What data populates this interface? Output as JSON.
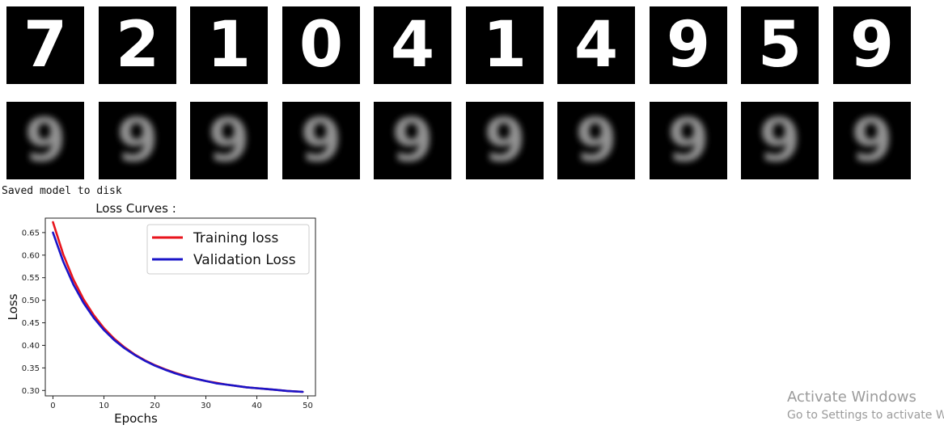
{
  "originals": [
    "7",
    "2",
    "1",
    "0",
    "4",
    "1",
    "4",
    "9",
    "5",
    "9"
  ],
  "reconstructions": [
    "9",
    "9",
    "9",
    "9",
    "9",
    "9",
    "9",
    "9",
    "9",
    "9"
  ],
  "status_text": "Saved model to disk",
  "chart_data": {
    "type": "line",
    "title": "Loss Curves :",
    "xlabel": "Epochs",
    "ylabel": "Loss",
    "xlim": [
      -1.5,
      51.5
    ],
    "ylim": [
      0.288,
      0.682
    ],
    "xticks": [
      0,
      10,
      20,
      30,
      40,
      50
    ],
    "yticks": [
      0.3,
      0.35,
      0.4,
      0.45,
      0.5,
      0.55,
      0.6,
      0.65
    ],
    "legend_position": "top-right",
    "series": [
      {
        "name": "Training loss",
        "color": "#e8141c",
        "x": [
          0,
          2,
          4,
          6,
          8,
          10,
          12,
          14,
          16,
          18,
          20,
          22,
          24,
          26,
          28,
          30,
          32,
          34,
          36,
          38,
          40,
          42,
          44,
          46,
          49
        ],
        "y": [
          0.673,
          0.602,
          0.546,
          0.502,
          0.467,
          0.438,
          0.415,
          0.396,
          0.38,
          0.367,
          0.356,
          0.347,
          0.339,
          0.332,
          0.326,
          0.321,
          0.317,
          0.313,
          0.31,
          0.307,
          0.305,
          0.303,
          0.301,
          0.299,
          0.297
        ]
      },
      {
        "name": "Validation Loss",
        "color": "#1a14c8",
        "x": [
          0,
          2,
          4,
          6,
          8,
          10,
          12,
          14,
          16,
          18,
          20,
          22,
          24,
          26,
          28,
          30,
          32,
          34,
          36,
          38,
          40,
          42,
          44,
          46,
          49
        ],
        "y": [
          0.65,
          0.586,
          0.535,
          0.494,
          0.461,
          0.434,
          0.412,
          0.394,
          0.379,
          0.366,
          0.355,
          0.346,
          0.338,
          0.331,
          0.326,
          0.321,
          0.316,
          0.313,
          0.31,
          0.307,
          0.305,
          0.303,
          0.301,
          0.299,
          0.297
        ]
      }
    ]
  },
  "watermark": {
    "line1": "Activate Windows",
    "line2": "Go to Settings to activate Wi"
  }
}
